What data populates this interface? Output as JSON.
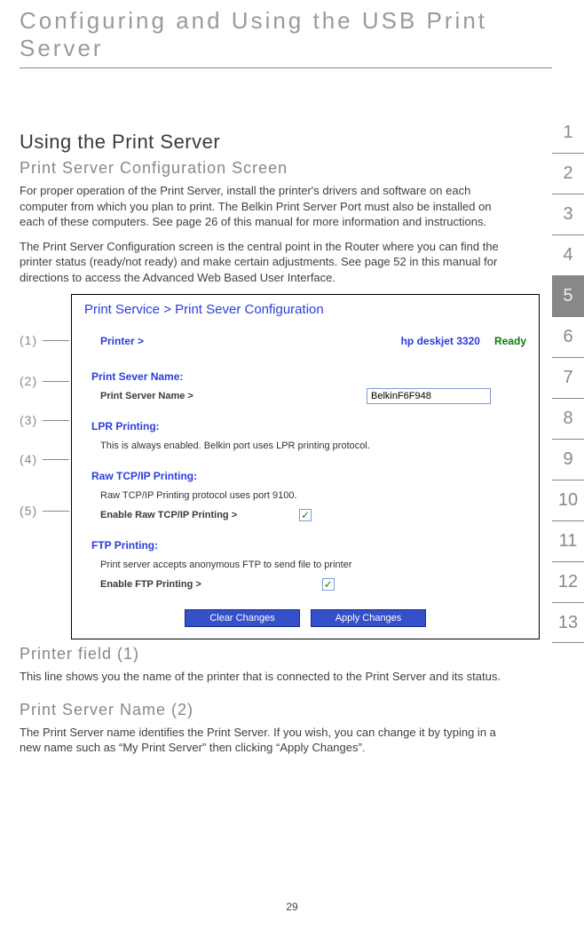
{
  "page_title": "Configuring and Using the USB Print Server",
  "section_nav": [
    "1",
    "2",
    "3",
    "4",
    "5",
    "6",
    "7",
    "8",
    "9",
    "10",
    "11",
    "12",
    "13"
  ],
  "active_section": "5",
  "h2_using": "Using the Print Server",
  "h3_config": "Print Server Configuration Screen",
  "para1": "For proper operation of the Print Server, install the printer's drivers and software on each computer from which you plan to print. The Belkin Print Server Port must also be installed on each of these computers. See page 26 of this manual for more information and instructions.",
  "para2": "The Print Server Configuration screen is the central point in the Router where you can find the printer status (ready/not ready) and make certain adjustments. See page 52 in this manual for directions to access the Advanced Web Based User Interface.",
  "callouts": [
    "(1)",
    "(2)",
    "(3)",
    "(4)",
    "(5)"
  ],
  "screenshot": {
    "breadcrumb": "Print Service > Print Sever Configuration",
    "printer_label": "Printer >",
    "printer_name": "hp deskjet 3320",
    "printer_status": "Ready",
    "psn_header": "Print Sever Name:",
    "psn_label": "Print Server Name >",
    "psn_value": "BelkinF6F948",
    "lpr_header": "LPR Printing:",
    "lpr_note": "This is always enabled. Belkin port uses LPR printing protocol.",
    "raw_header": "Raw TCP/IP Printing:",
    "raw_note": "Raw TCP/IP Printing protocol uses port 9100.",
    "raw_enable_label": "Enable Raw TCP/IP Printing >",
    "ftp_header": "FTP Printing:",
    "ftp_note": "Print server accepts anonymous FTP to send file to printer",
    "ftp_enable_label": "Enable FTP Printing >",
    "btn_clear": "Clear Changes",
    "btn_apply": "Apply Changes"
  },
  "h3_printer_field": "Printer field (1)",
  "para_printer_field": "This line shows you the name of the printer that is connected to the Print Server and its status.",
  "h3_psn": "Print Server Name (2)",
  "para_psn": "The Print Server name identifies the Print Server. If you wish, you can change it by typing in a new name such as “My Print Server” then clicking “Apply Changes”.",
  "page_number": "29"
}
